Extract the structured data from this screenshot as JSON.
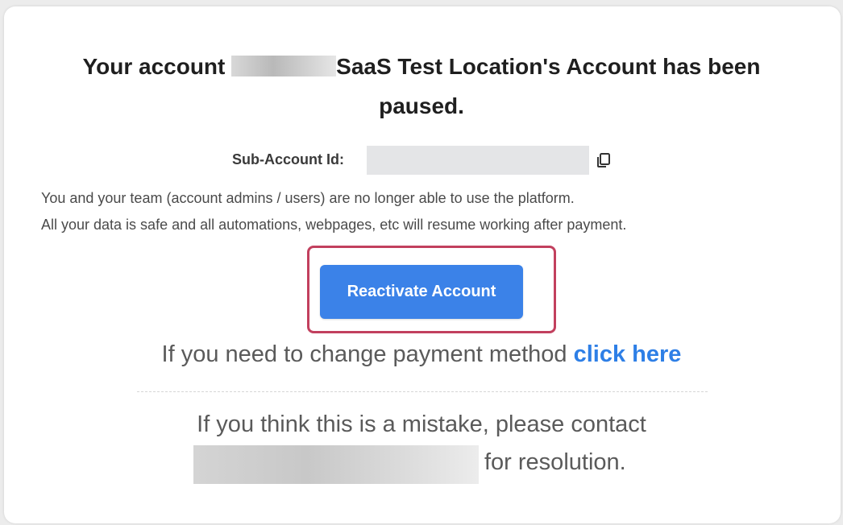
{
  "title": {
    "prefix": "Your account",
    "suffix": "SaaS Test Location's Account has been",
    "line2": "paused."
  },
  "sub_account": {
    "label": "Sub-Account Id:",
    "copy_icon": "copy-icon"
  },
  "info": {
    "line1": "You and your team (account admins / users) are no longer able to use the platform.",
    "line2": "All your data is safe and all automations, webpages, etc will resume working after payment."
  },
  "reactivate_button": {
    "label": "Reactivate Account"
  },
  "payment": {
    "text": "If you need to change payment method",
    "link": "click here"
  },
  "mistake": {
    "text": "If you think this is a mistake, please contact",
    "suffix": "for resolution."
  },
  "colors": {
    "button": "#3b82e8",
    "highlight_border": "#c2405e",
    "link": "#2e7fe6"
  }
}
